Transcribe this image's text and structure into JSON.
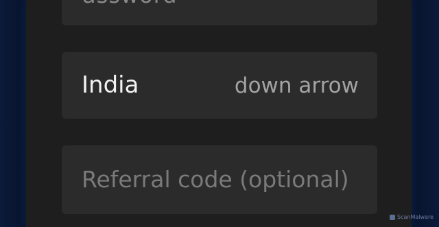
{
  "form": {
    "password_placeholder_fragment": "assword",
    "country": {
      "selected": "India",
      "arrow_label": "down arrow"
    },
    "referral": {
      "placeholder": "Referral code (optional)",
      "value": ""
    }
  },
  "watermark": {
    "text": "ScanMalware"
  },
  "colors": {
    "background": "#1e1e1e",
    "field": "#2b2b2b",
    "value_text": "#f2f2f2",
    "placeholder_text": "#7a7a7a",
    "frame": "#08142c"
  }
}
